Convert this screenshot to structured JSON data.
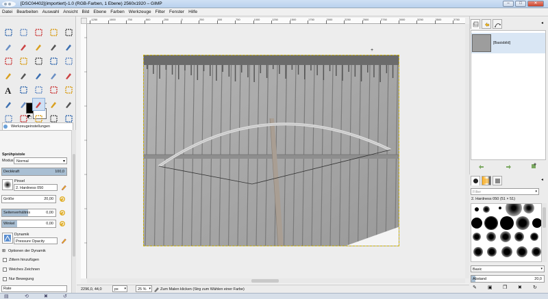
{
  "window": {
    "title": "[DSC04402](importiert)-1.0 (RGB-Farben, 1 Ebene) 2560x1920 – GIMP",
    "min_label": "–",
    "max_label": "□",
    "close_label": "✕"
  },
  "menu": [
    "Datei",
    "Bearbeiten",
    "Auswahl",
    "Ansicht",
    "Bild",
    "Ebene",
    "Farben",
    "Werkzeuge",
    "Filter",
    "Fenster",
    "Hilfe"
  ],
  "tools": [
    [
      "rect-select",
      "ellipse-select",
      "free-select",
      "fuzzy-select",
      "zoom-tool"
    ],
    [
      "scissors",
      "foreground-select",
      "paths",
      "color-picker",
      "magnify"
    ],
    [
      "move",
      "align",
      "crop",
      "rotate",
      "scale"
    ],
    [
      "shear",
      "perspective",
      "flip",
      "cage",
      "warp"
    ],
    [
      "text",
      "bucket-fill",
      "blend",
      "pencil",
      "paintbrush"
    ],
    [
      "eraser",
      "airbrush",
      "ink",
      "clone",
      "heal"
    ],
    [
      "perspective-clone",
      "smudge",
      "dodge-burn",
      "blur",
      "dodge"
    ]
  ],
  "colors": {
    "fg": "#000000",
    "bg": "#ffffff",
    "accent": "#cfe0f4"
  },
  "tool_options": {
    "tab_label": "Werkzeugeinstellungen",
    "title": "Sprühpistole",
    "mode_label": "Modus:",
    "mode_value": "Normal",
    "opacity_label": "Deckkraft",
    "opacity_value": "100,0",
    "brush_label": "Pinsel",
    "brush_value": "2. Hardness 050",
    "size_label": "Größe",
    "size_value": "20,00",
    "aspect_label": "Seitenverhältnis",
    "aspect_value": "0,00",
    "angle_label": "Winkel",
    "angle_value": "0,00",
    "dynamics_label": "Dynamik",
    "dynamics_value": "Pressure Opacity",
    "dyn_options": "Optionen der Dynamik",
    "jitter": "Zittern hinzufügen",
    "smooth": "Weiches Zeichnen",
    "motion_only": "Nur Bewegung",
    "rate": "Rate"
  },
  "ruler": {
    "h_ticks": [
      "-1250",
      "-1000",
      "-750",
      "-500",
      "-250",
      "0",
      "250",
      "500",
      "750",
      "1000",
      "1250",
      "1500",
      "1750",
      "2000",
      "2250",
      "2500",
      "2750",
      "3000",
      "3250",
      "3500",
      "3750"
    ]
  },
  "status": {
    "coords": "2296,0, 44,0",
    "unit": "px",
    "zoom": "25 %",
    "message": "Zum Malen klicken (Strg zum Wählen einer Farbe)"
  },
  "layers": {
    "name": "[Basisbild]"
  },
  "brushes": {
    "filter_placeholder": "Filter",
    "selected": "2. Hardness 050 (51 × 51)",
    "category": "Basic",
    "spacing_label": "Abstand",
    "spacing_value": "20,0"
  }
}
